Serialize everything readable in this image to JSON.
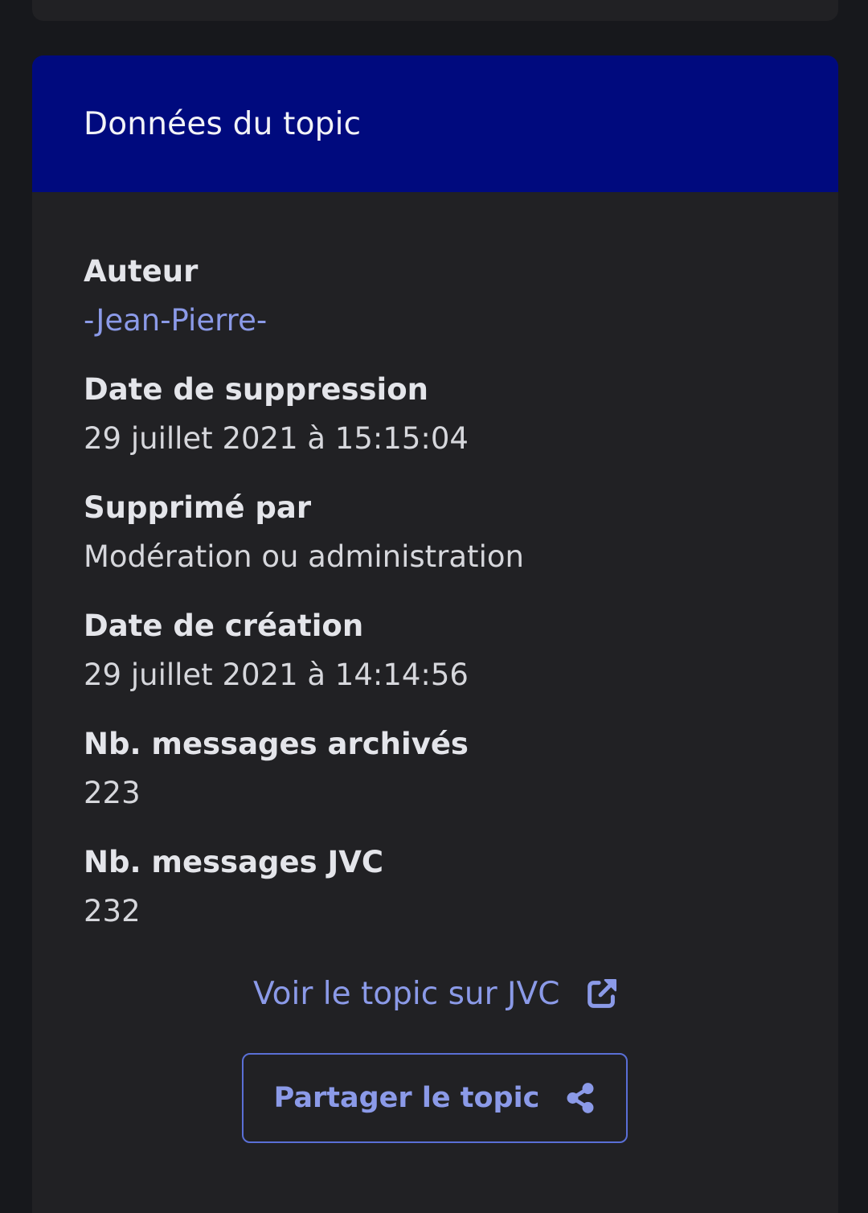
{
  "card": {
    "title": "Données du topic",
    "fields": [
      {
        "label": "Auteur",
        "value": "-Jean-Pierre-"
      },
      {
        "label": "Date de suppression",
        "value": "29 juillet 2021 à 15:15:04"
      },
      {
        "label": "Supprimé par",
        "value": "Modération ou administration"
      },
      {
        "label": "Date de création",
        "value": "29 juillet 2021 à 14:14:56"
      },
      {
        "label": "Nb. messages archivés",
        "value": "223"
      },
      {
        "label": "Nb. messages JVC",
        "value": "232"
      }
    ],
    "jvc_link_label": "Voir le topic sur JVC",
    "share_button_label": "Partager le topic"
  },
  "icons": {
    "external_link": "external-link-icon",
    "share": "share-icon"
  },
  "colors": {
    "background": "#17181c",
    "card_background": "#212124",
    "header_background": "#000a7e",
    "accent": "#8b9ae8",
    "button_border": "#5a6fd6"
  }
}
